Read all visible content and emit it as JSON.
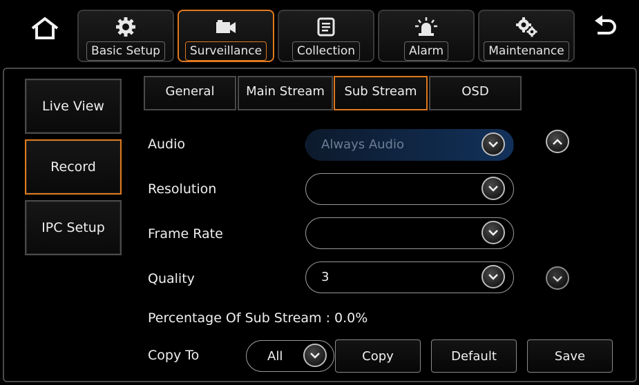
{
  "top_nav": {
    "home_icon": "home-icon",
    "back_icon": "back-arrow-icon",
    "tabs": [
      {
        "label": "Basic Setup",
        "icon": "gear-icon"
      },
      {
        "label": "Surveillance",
        "icon": "camera-icon"
      },
      {
        "label": "Collection",
        "icon": "document-icon"
      },
      {
        "label": "Alarm",
        "icon": "alarm-light-icon"
      },
      {
        "label": "Maintenance",
        "icon": "gears-icon"
      }
    ],
    "active_tab": "Surveillance"
  },
  "sidebar": {
    "items": [
      {
        "label": "Live View"
      },
      {
        "label": "Record"
      },
      {
        "label": "IPC Setup"
      }
    ],
    "active_item": "Record"
  },
  "sub_tabs": {
    "items": [
      {
        "label": "General"
      },
      {
        "label": "Main Stream"
      },
      {
        "label": "Sub Stream"
      },
      {
        "label": "OSD"
      }
    ],
    "active": "Sub Stream"
  },
  "form": {
    "audio": {
      "label": "Audio",
      "value": "Always Audio"
    },
    "resolution": {
      "label": "Resolution",
      "value": ""
    },
    "frame_rate": {
      "label": "Frame Rate",
      "value": ""
    },
    "quality": {
      "label": "Quality",
      "value": "3"
    },
    "percentage_text": "Percentage Of Sub Stream : 0.0%",
    "copy_to": {
      "label": "Copy To",
      "value": "All"
    }
  },
  "actions": {
    "copy": "Copy",
    "default": "Default",
    "save": "Save"
  },
  "colors": {
    "accent": "#e07a1e",
    "border": "#4a4a4a",
    "disabled_fill": "#12315a",
    "background": "#000000"
  }
}
